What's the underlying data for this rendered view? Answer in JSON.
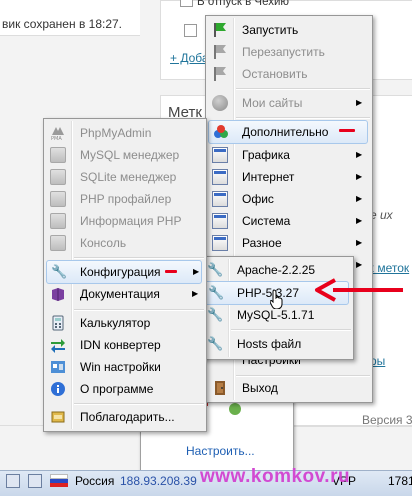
{
  "background": {
    "save_message": "вик сохранен в 18:27.",
    "checkbox_label": "В отпуск в Чехию",
    "add_link": "+ Доба",
    "tags_title": "Метк",
    "right_text_1": "е их",
    "right_link_tags": "х меток",
    "right_link_2": "ры",
    "version": "Версия 3"
  },
  "tray": {
    "customize": "Настроить..."
  },
  "taskbar": {
    "language": "Россия",
    "ip": "188.93.208.39",
    "extra": "Директ",
    "ts": "VPP",
    "clock": "1781"
  },
  "watermark": "www.komkov.ru",
  "main_menu": {
    "items": [
      {
        "label": "Запустить",
        "icon": "green-flag-icon",
        "enabled": true
      },
      {
        "label": "Перезапустить",
        "icon": "gray-flag-icon",
        "enabled": false
      },
      {
        "label": "Остановить",
        "icon": "gray-flag-icon",
        "enabled": false
      },
      {
        "label": "Мои сайты",
        "icon": "gray-circle-icon",
        "enabled": false,
        "submenu": true
      },
      {
        "label": "Дополнительно",
        "icon": "colored-circles-icon",
        "enabled": true,
        "submenu": true
      },
      {
        "label": "Графика",
        "icon": "window-icon",
        "enabled": true,
        "submenu": true
      },
      {
        "label": "Интернет",
        "icon": "window-icon",
        "enabled": true,
        "submenu": true
      },
      {
        "label": "Офис",
        "icon": "window-icon",
        "enabled": true,
        "submenu": true
      },
      {
        "label": "Система",
        "icon": "window-icon",
        "enabled": true,
        "submenu": true
      },
      {
        "label": "Разное",
        "icon": "window-icon",
        "enabled": true,
        "submenu": true
      },
      {
        "label": "Настройки",
        "icon": "settings-icon",
        "enabled": true
      },
      {
        "label": "Выход",
        "icon": "exit-door-icon",
        "enabled": true
      }
    ]
  },
  "left_menu": {
    "items": [
      {
        "label": "PhpMyAdmin",
        "enabled": false
      },
      {
        "label": "MySQL менеджер",
        "enabled": false
      },
      {
        "label": "SQLite менеджер",
        "enabled": false
      },
      {
        "label": "PHP профайлер",
        "enabled": false
      },
      {
        "label": "Информация PHP",
        "enabled": false
      },
      {
        "label": "Консоль",
        "enabled": false
      },
      {
        "label": "Конфигурация",
        "enabled": true
      },
      {
        "label": "Документация",
        "enabled": true
      },
      {
        "label": "Калькулятор",
        "enabled": true
      },
      {
        "label": "IDN конвертер",
        "enabled": true
      },
      {
        "label": "Win настройки",
        "enabled": true
      },
      {
        "label": "О программе",
        "enabled": true
      },
      {
        "label": "Поблагодарить...",
        "enabled": true
      }
    ]
  },
  "config_menu": {
    "items": [
      {
        "label": "Apache-2.2.25"
      },
      {
        "label": "PHP-5.3.27"
      },
      {
        "label": "MySQL-5.1.71"
      },
      {
        "label": "Hosts файл"
      }
    ]
  },
  "colors": {
    "annotation_red": "#e8001c",
    "highlight": "#dce9f8",
    "link": "#21759b"
  }
}
